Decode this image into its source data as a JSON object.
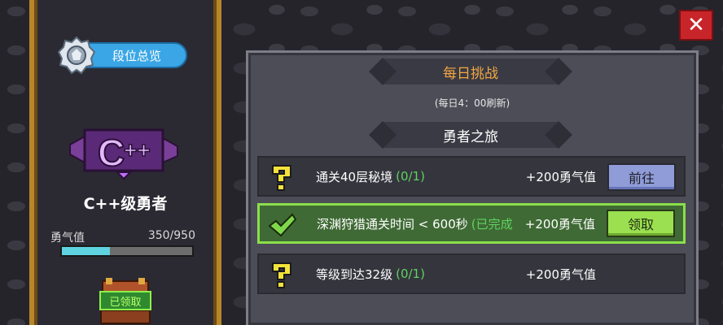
{
  "rank": {
    "overview_label": "段位总览",
    "name": "C++级勇者",
    "courage_label": "勇气值",
    "courage_value": "350/950",
    "courage_progress": 0.368,
    "chest_label": "已领取"
  },
  "challenge": {
    "daily_title": "每日挑战",
    "refresh_note": "(每日4：00刷新)",
    "section_title": "勇者之旅",
    "tasks": [
      {
        "title": "通关40层秘境",
        "progress": "(0/1)",
        "reward": "+200勇气值",
        "action": "前往",
        "status": "pending"
      },
      {
        "title": "深渊狩猎通关时间 < 600秒",
        "progress": "(已完成",
        "reward": "+200勇气值",
        "action": "领取",
        "status": "done"
      },
      {
        "title": "等级到达32级",
        "progress": "(0/1)",
        "reward": "+200勇气值",
        "action": "",
        "status": "pending"
      }
    ]
  },
  "colors": {
    "accent_orange": "#f2a742",
    "done_green": "#8ae04b",
    "close_red": "#c8252a"
  }
}
